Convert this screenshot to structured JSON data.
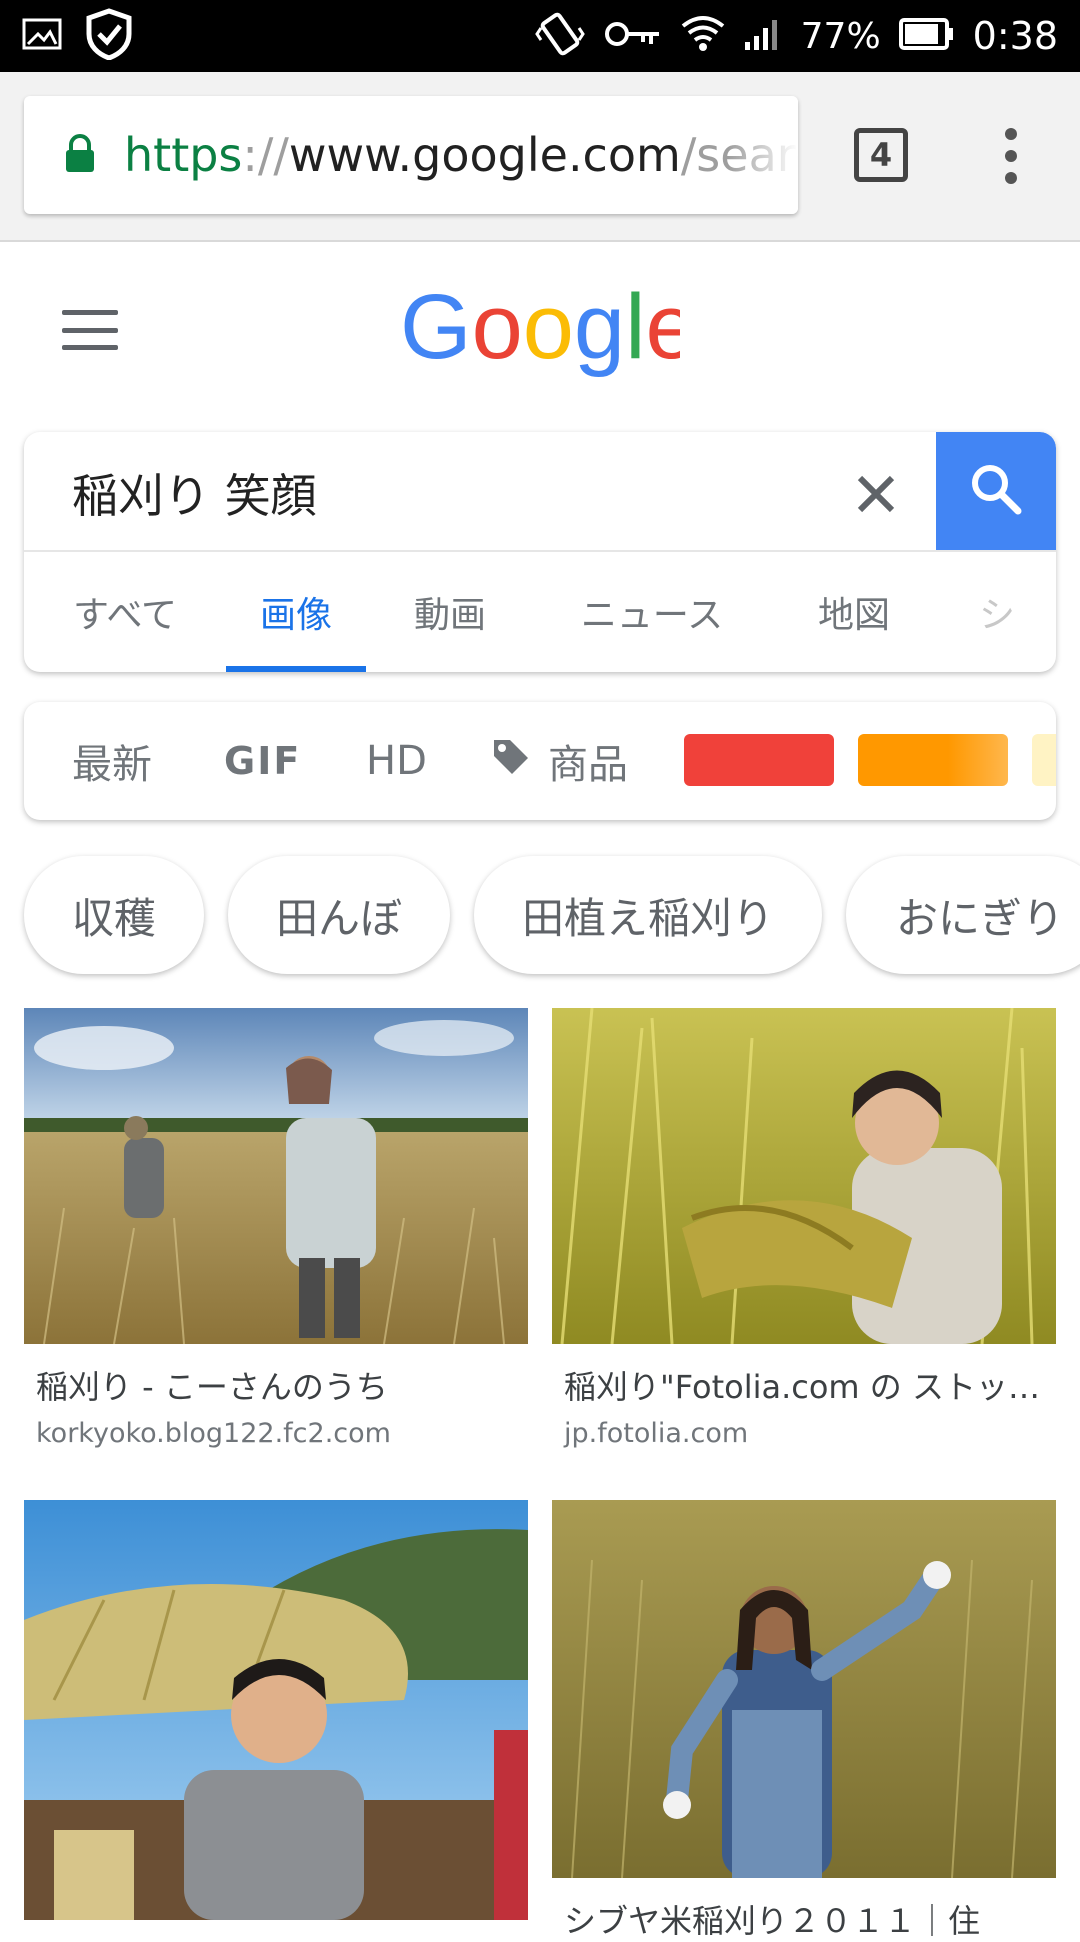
{
  "status_bar": {
    "battery": "77%",
    "time": "0:38",
    "icons": [
      "gallery-icon",
      "shield-check-icon",
      "vibrate-icon",
      "vpn-key-icon",
      "wifi-icon",
      "signal-icon",
      "battery-icon"
    ]
  },
  "browser": {
    "url_scheme": "https",
    "url_sep": "://",
    "url_host": "www.google.com",
    "url_path": "/search",
    "tab_count": "4"
  },
  "search": {
    "query": "稲刈り 笑顔",
    "tabs": [
      "すべて",
      "画像",
      "動画",
      "ニュース",
      "地図",
      "シ"
    ],
    "active_tab": "画像"
  },
  "filters": {
    "items": [
      "最新",
      "GIF",
      "HD",
      "商品"
    ],
    "color_swatches": [
      "#f0413a",
      "#ff9800",
      "#fff3c4"
    ]
  },
  "chips": [
    "収穫",
    "田んぼ",
    "田植え稲刈り",
    "おにぎり"
  ],
  "results": [
    {
      "title": "稲刈り - こーさんのうち",
      "domain": "korkyoko.blog122.fc2.com"
    },
    {
      "title": "稲刈り\"Fotolia.com の ストッ…",
      "domain": "jp.fotolia.com"
    },
    {
      "title": "",
      "domain": ""
    },
    {
      "title": "シブヤ米稲刈り２０１１｜住",
      "domain": ""
    }
  ],
  "colors": {
    "google_blue": "#4285f4",
    "active_tab": "#1a73e8"
  }
}
